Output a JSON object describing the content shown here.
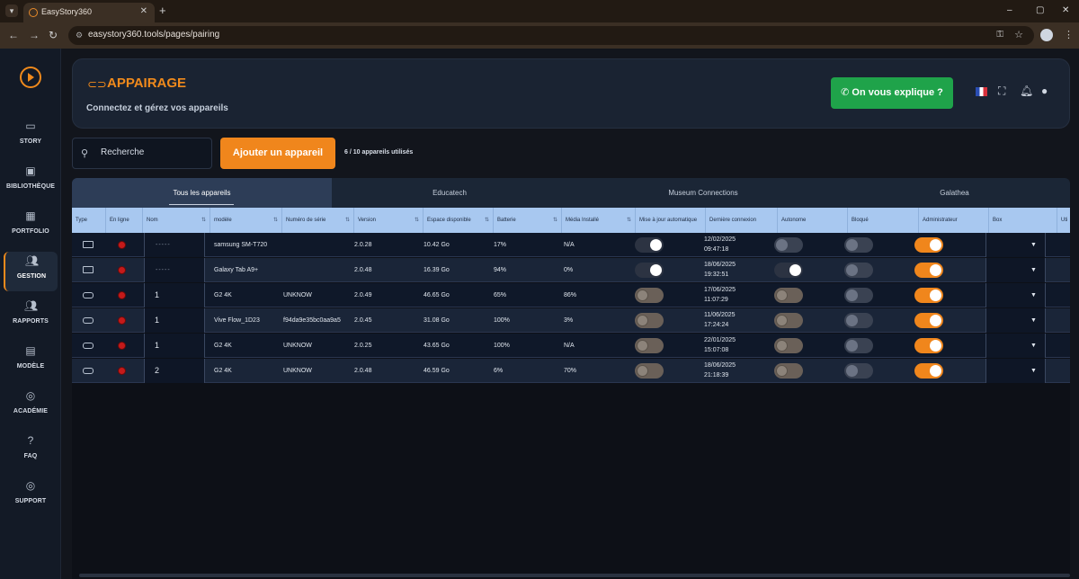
{
  "browser": {
    "tab_title": "EasyStory360",
    "url": "easystory360.tools/pages/pairing",
    "window_controls": [
      "–",
      "▢",
      "✕"
    ]
  },
  "sidebar": {
    "items": [
      {
        "label": "STORY",
        "icon": "laptop-icon"
      },
      {
        "label": "BIBLIOTHÈQUE",
        "icon": "image-library-icon"
      },
      {
        "label": "PORTFOLIO",
        "icon": "grid-icon"
      },
      {
        "label": "GESTION",
        "icon": "users-icon",
        "active": true
      },
      {
        "label": "RAPPORTS",
        "icon": "users-report-icon"
      },
      {
        "label": "MODÈLE",
        "icon": "template-icon"
      },
      {
        "label": "ACADÉMIE",
        "icon": "lifebuoy-icon"
      },
      {
        "label": "FAQ",
        "icon": "question-icon"
      },
      {
        "label": "SUPPORT",
        "icon": "support-icon"
      }
    ]
  },
  "header": {
    "title": "APPAIRAGE",
    "subtitle": "Connectez et gérez vos appareils",
    "explain_button": "On vous explique ?"
  },
  "toolbar": {
    "search_placeholder": "Recherche",
    "add_button": "Ajouter un appareil",
    "usage": "6 / 10 appareils utilisés"
  },
  "filter_tabs": [
    "Tous les appareils",
    "Educatech",
    "Museum Connections",
    "Galathea"
  ],
  "table": {
    "columns": [
      "Type",
      "En ligne",
      "Nom",
      "modèle",
      "Numéro de série",
      "Version",
      "Espace disponible",
      "Batterie",
      "Média Installé",
      "Mise à jour automatique",
      "Dernière connexion",
      "Autonome",
      "Bloqué",
      "Administrateur",
      "Box",
      "Uti"
    ],
    "rows": [
      {
        "type": "tablet",
        "name": "-----",
        "model": "samsung SM-T720",
        "serial": "",
        "version": "2.0.28",
        "space": "10.42 Go",
        "battery": "17%",
        "media": "N/A",
        "auto_update": "on",
        "last_date": "12/02/2025",
        "last_time": "09:47:18",
        "autonomous": "off",
        "blocked": "off",
        "admin": "on"
      },
      {
        "type": "tablet",
        "name": "-----",
        "model": "Galaxy Tab A9+",
        "serial": "",
        "version": "2.0.48",
        "space": "16.39 Go",
        "battery": "94%",
        "media": "0%",
        "auto_update": "on",
        "last_date": "18/06/2025",
        "last_time": "19:32:51",
        "autonomous": "on",
        "blocked": "off",
        "admin": "on"
      },
      {
        "type": "vr",
        "name": "1",
        "model": "G2 4K",
        "serial": "UNKNOW",
        "version": "2.0.49",
        "space": "46.65 Go",
        "battery": "65%",
        "media": "86%",
        "auto_update": "disabled",
        "last_date": "17/06/2025",
        "last_time": "11:07:29",
        "autonomous": "disabled",
        "blocked": "off",
        "admin": "on"
      },
      {
        "type": "vr",
        "name": "1",
        "model": "Vive Flow_1D23",
        "serial": "f94da9e35bc0aa9a5",
        "version": "2.0.45",
        "space": "31.08 Go",
        "battery": "100%",
        "media": "3%",
        "auto_update": "disabled",
        "last_date": "11/06/2025",
        "last_time": "17:24:24",
        "autonomous": "disabled",
        "blocked": "off",
        "admin": "on"
      },
      {
        "type": "vr",
        "name": "1",
        "model": "G2 4K",
        "serial": "UNKNOW",
        "version": "2.0.25",
        "space": "43.65 Go",
        "battery": "100%",
        "media": "N/A",
        "auto_update": "disabled",
        "last_date": "22/01/2025",
        "last_time": "15:07:08",
        "autonomous": "disabled",
        "blocked": "off",
        "admin": "on"
      },
      {
        "type": "vr",
        "name": "2",
        "model": "G2 4K",
        "serial": "UNKNOW",
        "version": "2.0.48",
        "space": "46.59 Go",
        "battery": "6%",
        "media": "70%",
        "auto_update": "disabled",
        "last_date": "18/06/2025",
        "last_time": "21:18:39",
        "autonomous": "disabled",
        "blocked": "off",
        "admin": "on"
      }
    ]
  },
  "colors": {
    "accent": "#f0861c",
    "explain": "#1fa34a",
    "offline": "#c41a1a",
    "header_row": "#a8c8f0"
  }
}
